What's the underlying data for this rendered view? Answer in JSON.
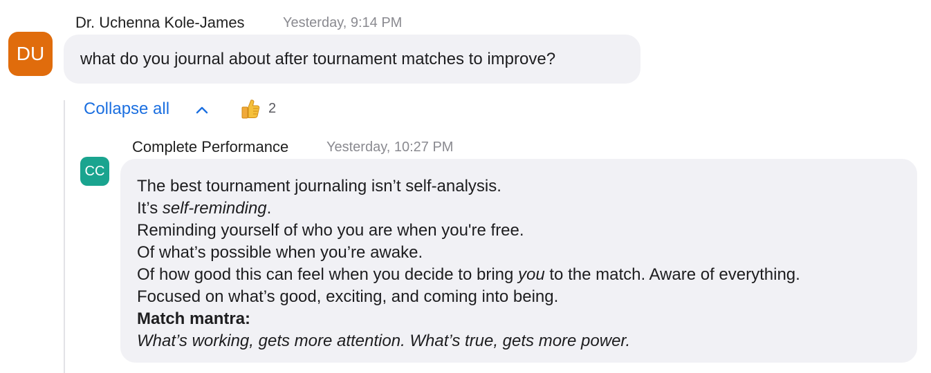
{
  "message": {
    "avatar_initials": "DU",
    "avatar_color": "#e06c0c",
    "sender": "Dr. Uchenna Kole-James",
    "timestamp": "Yesterday, 9:14 PM",
    "text": "what do you journal about after tournament matches to improve?"
  },
  "thread": {
    "collapse_label": "Collapse all",
    "collapse_icon": "chevron-up-icon",
    "reaction": {
      "emoji": "thumbs-up-icon",
      "count": "2"
    }
  },
  "reply": {
    "avatar_initials": "CC",
    "avatar_color": "#1aa48f",
    "sender": "Complete Performance",
    "timestamp": "Yesterday, 10:27 PM",
    "lines": {
      "l1": "The best tournament journaling isn’t self-analysis.",
      "l2_prefix": "It’s ",
      "l2_em": "self-reminding",
      "l2_suffix": ".",
      "l3": "Reminding yourself of who you are when you're free.",
      "l4": "Of what’s possible when you’re awake.",
      "l5_prefix": "Of how good this can feel when you decide to bring ",
      "l5_em": "you",
      "l5_suffix": " to the match. Aware of everything.",
      "l6": "Focused on what’s good, exciting, and coming into being.",
      "l7_bold": "Match mantra:",
      "l8_em": "What’s working, gets more attention. What’s true, gets more power."
    }
  },
  "colors": {
    "link": "#1b6fe0",
    "bubble": "#f1f1f5",
    "timestamp": "#8a8a90"
  }
}
